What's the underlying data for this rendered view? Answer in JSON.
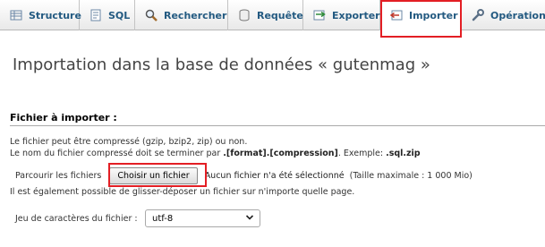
{
  "tabs": [
    {
      "id": "structure",
      "label": "Structure",
      "icon": "structure-icon"
    },
    {
      "id": "sql",
      "label": "SQL",
      "icon": "sql-icon"
    },
    {
      "id": "search",
      "label": "Rechercher",
      "icon": "search-icon"
    },
    {
      "id": "query",
      "label": "Requête",
      "icon": "query-icon"
    },
    {
      "id": "export",
      "label": "Exporter",
      "icon": "export-icon"
    },
    {
      "id": "import",
      "label": "Importer",
      "icon": "import-icon",
      "active": true
    },
    {
      "id": "operations",
      "label": "Opérations",
      "icon": "wrench-icon"
    }
  ],
  "page": {
    "title": "Importation dans la base de données « gutenmag »"
  },
  "file_section": {
    "title": "Fichier à importer :",
    "compress_note": "Le fichier peut être compressé (gzip, bzip2, zip) ou non.",
    "name_note_prefix": "Le nom du fichier compressé doit se terminer par ",
    "name_note_format": ".[format].[compression]",
    "name_note_example_prefix": ". Exemple: ",
    "name_note_example": ".sql.zip",
    "browse_label": "Parcourir les fichiers",
    "choose_button": "Choisir un fichier",
    "file_status": "Aucun fichier n'a été sélectionné",
    "max_size": "(Taille maximale : 1 000 Mio)",
    "drag_note": "Il est également possible de glisser-déposer un fichier sur n'importe quelle page."
  },
  "charset": {
    "label": "Jeu de caractères du fichier :",
    "value": "utf-8"
  },
  "colors": {
    "tab_text": "#235a81",
    "highlight": "#e31e24"
  }
}
